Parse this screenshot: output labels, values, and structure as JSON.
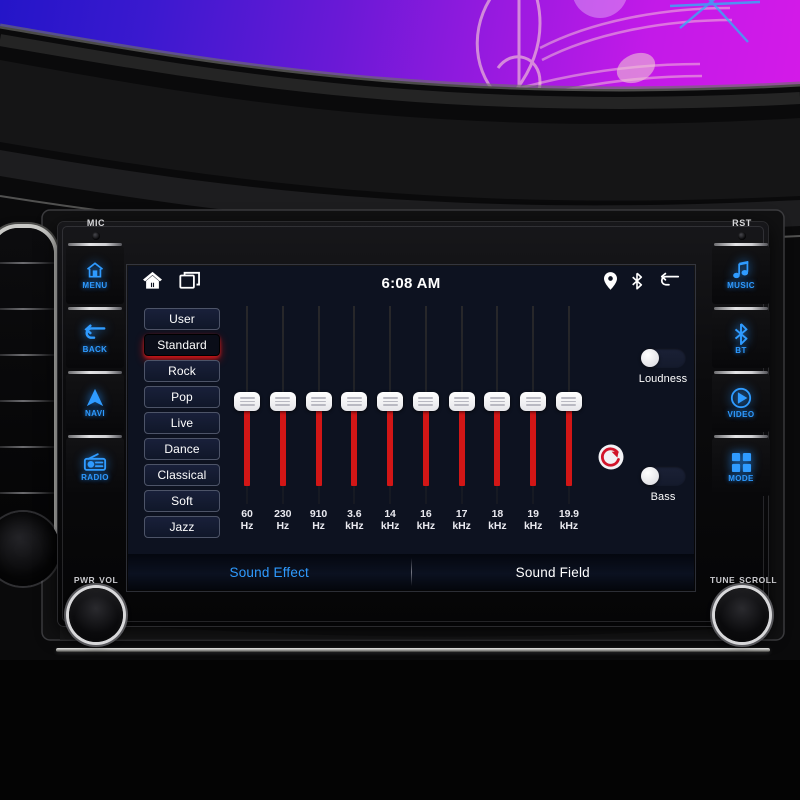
{
  "device": {
    "left_panel": {
      "mic_label": "MIC",
      "buttons": [
        {
          "label": "MENU",
          "icon": "home-icon"
        },
        {
          "label": "BACK",
          "icon": "back-arrow-icon"
        },
        {
          "label": "NAVI",
          "icon": "navigation-arrow-icon"
        },
        {
          "label": "RADIO",
          "icon": "radio-icon"
        }
      ],
      "knob": {
        "label_a": "PWR",
        "label_b": "VOL"
      }
    },
    "right_panel": {
      "reset_label": "RST",
      "buttons": [
        {
          "label": "MUSIC",
          "icon": "music-note-icon"
        },
        {
          "label": "BT",
          "icon": "bluetooth-icon"
        },
        {
          "label": "VIDEO",
          "icon": "play-circle-icon"
        },
        {
          "label": "MODE",
          "icon": "grid-squares-icon"
        }
      ],
      "knob": {
        "label_a": "TUNE",
        "label_b": "SCROLL"
      }
    },
    "button_glow_color": "#2f9bff"
  },
  "screen": {
    "statusbar": {
      "home_icon": "home-icon",
      "recents_icon": "multi-window-icon",
      "time": "6:08 AM",
      "location_icon": "location-pin-icon",
      "bluetooth_icon": "bluetooth-icon",
      "back_icon": "back-arrow-icon"
    },
    "presets": {
      "items": [
        {
          "label": "User",
          "active": false
        },
        {
          "label": "Standard",
          "active": true
        },
        {
          "label": "Rock",
          "active": false
        },
        {
          "label": "Pop",
          "active": false
        },
        {
          "label": "Live",
          "active": false
        },
        {
          "label": "Dance",
          "active": false
        },
        {
          "label": "Classical",
          "active": false
        },
        {
          "label": "Soft",
          "active": false
        },
        {
          "label": "Jazz",
          "active": false
        }
      ],
      "active_glow_color": "#d61212"
    },
    "equalizer": {
      "bands": [
        {
          "freq_value": "60",
          "freq_unit": "Hz",
          "position_pct": 50
        },
        {
          "freq_value": "230",
          "freq_unit": "Hz",
          "position_pct": 50
        },
        {
          "freq_value": "910",
          "freq_unit": "Hz",
          "position_pct": 50
        },
        {
          "freq_value": "3.6",
          "freq_unit": "kHz",
          "position_pct": 50
        },
        {
          "freq_value": "14",
          "freq_unit": "kHz",
          "position_pct": 50
        },
        {
          "freq_value": "16",
          "freq_unit": "kHz",
          "position_pct": 50
        },
        {
          "freq_value": "17",
          "freq_unit": "kHz",
          "position_pct": 50
        },
        {
          "freq_value": "18",
          "freq_unit": "kHz",
          "position_pct": 50
        },
        {
          "freq_value": "19",
          "freq_unit": "kHz",
          "position_pct": 50
        },
        {
          "freq_value": "19.9",
          "freq_unit": "kHz",
          "position_pct": 50
        }
      ],
      "slider_fill_color": "#d21616",
      "reset_icon": "reset-circle-arrow-icon",
      "reset_color": "#d2152a"
    },
    "toggles": [
      {
        "label": "Loudness",
        "on": false
      },
      {
        "label": "Bass",
        "on": false
      }
    ],
    "tabs": [
      {
        "label": "Sound Effect",
        "active": true
      },
      {
        "label": "Sound Field",
        "active": false
      }
    ],
    "tab_active_color": "#2f9bff",
    "background_color": "#0d1220"
  }
}
